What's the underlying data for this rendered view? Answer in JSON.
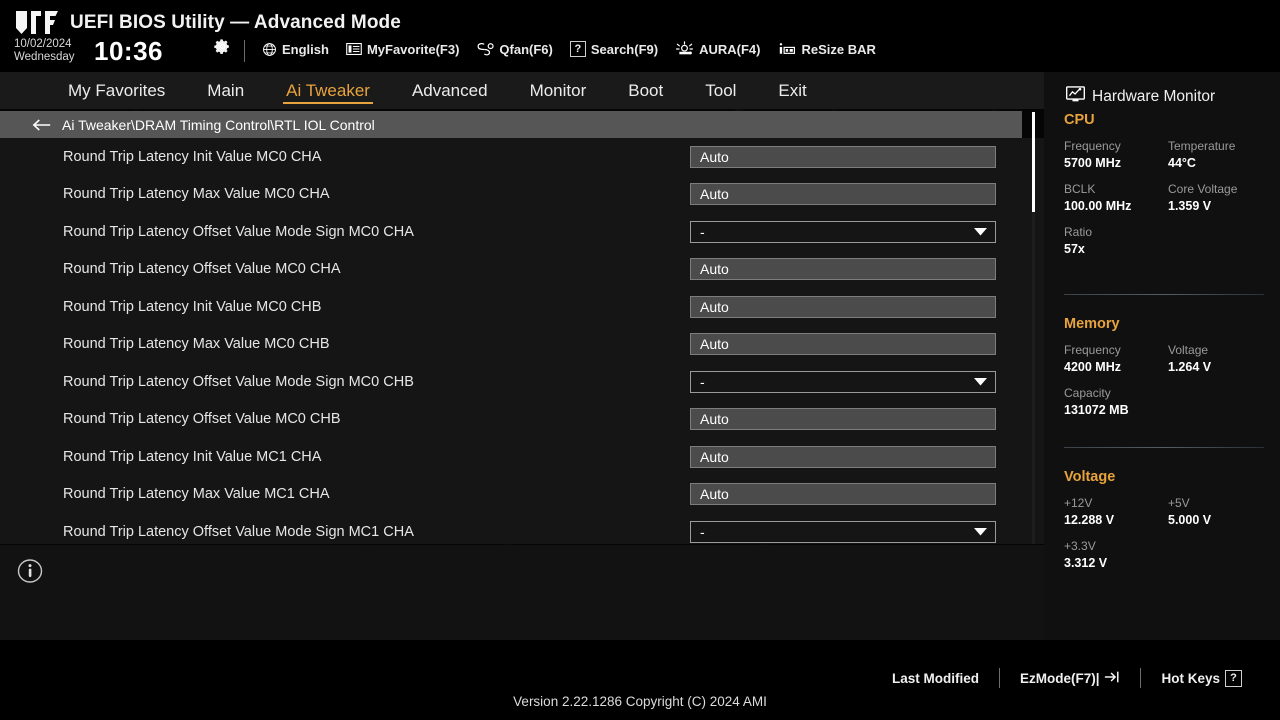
{
  "header": {
    "logo_name": "tuf-gaming-logo",
    "title": "UEFI BIOS Utility — Advanced Mode",
    "date": "10/02/2024",
    "weekday": "Wednesday",
    "time": "10:36",
    "gear_icon": "gear-icon",
    "tools": [
      {
        "icon": "globe-icon",
        "label": "English"
      },
      {
        "icon": "myfavorite-icon",
        "label": "MyFavorite(F3)"
      },
      {
        "icon": "qfan-icon",
        "label": "Qfan(F6)"
      },
      {
        "icon": "question-box-icon",
        "label": "Search(F9)"
      },
      {
        "icon": "aura-icon",
        "label": "AURA(F4)"
      },
      {
        "icon": "resize-bar-icon",
        "label": "ReSize BAR"
      }
    ]
  },
  "tabs": [
    {
      "label": "My Favorites",
      "active": false
    },
    {
      "label": "Main",
      "active": false
    },
    {
      "label": "Ai Tweaker",
      "active": true
    },
    {
      "label": "Advanced",
      "active": false
    },
    {
      "label": "Monitor",
      "active": false
    },
    {
      "label": "Boot",
      "active": false
    },
    {
      "label": "Tool",
      "active": false
    },
    {
      "label": "Exit",
      "active": false
    }
  ],
  "breadcrumb": {
    "back_icon": "back-arrow-icon",
    "path": "Ai Tweaker\\DRAM Timing Control\\RTL IOL Control"
  },
  "settings": [
    {
      "label": "Round Trip Latency Init Value MC0 CHA",
      "value": "Auto",
      "type": "text"
    },
    {
      "label": "Round Trip Latency Max Value MC0 CHA",
      "value": "Auto",
      "type": "text"
    },
    {
      "label": "Round Trip Latency Offset Value Mode Sign MC0 CHA",
      "value": "-",
      "type": "select"
    },
    {
      "label": "Round Trip Latency Offset Value MC0 CHA",
      "value": "Auto",
      "type": "text"
    },
    {
      "label": "Round Trip Latency Init Value MC0 CHB",
      "value": "Auto",
      "type": "text"
    },
    {
      "label": "Round Trip Latency Max Value MC0 CHB",
      "value": "Auto",
      "type": "text"
    },
    {
      "label": "Round Trip Latency Offset Value Mode Sign MC0 CHB",
      "value": "-",
      "type": "select"
    },
    {
      "label": "Round Trip Latency Offset Value MC0 CHB",
      "value": "Auto",
      "type": "text"
    },
    {
      "label": "Round Trip Latency Init Value MC1 CHA",
      "value": "Auto",
      "type": "text"
    },
    {
      "label": "Round Trip Latency Max Value MC1 CHA",
      "value": "Auto",
      "type": "text"
    },
    {
      "label": "Round Trip Latency Offset Value Mode Sign MC1 CHA",
      "value": "-",
      "type": "select"
    }
  ],
  "help": {
    "info_icon": "info-icon",
    "text": ""
  },
  "hardware_monitor": {
    "icon": "monitor-icon",
    "title": "Hardware Monitor",
    "sections": [
      {
        "name": "CPU",
        "items": [
          {
            "key": "Frequency",
            "value": "5700 MHz"
          },
          {
            "key": "Temperature",
            "value": "44°C"
          },
          {
            "key": "BCLK",
            "value": "100.00 MHz"
          },
          {
            "key": "Core Voltage",
            "value": "1.359 V"
          },
          {
            "key": "Ratio",
            "value": "57x"
          }
        ]
      },
      {
        "name": "Memory",
        "items": [
          {
            "key": "Frequency",
            "value": "4200 MHz"
          },
          {
            "key": "Voltage",
            "value": "1.264 V"
          },
          {
            "key": "Capacity",
            "value": "131072 MB"
          }
        ]
      },
      {
        "name": "Voltage",
        "items": [
          {
            "key": "+12V",
            "value": "12.288 V"
          },
          {
            "key": "+5V",
            "value": "5.000 V"
          },
          {
            "key": "+3.3V",
            "value": "3.312 V"
          }
        ]
      }
    ]
  },
  "footer": {
    "links": [
      {
        "label": "Last Modified",
        "icon": ""
      },
      {
        "label": "EzMode(F7)|",
        "icon": "exit-arrow-icon"
      },
      {
        "label": "Hot Keys",
        "icon": "question-box-icon"
      }
    ],
    "version": "Version 2.22.1286 Copyright (C) 2024 AMI"
  },
  "colors": {
    "accent": "#e8a33d",
    "breadcrumb_bg": "#565656",
    "content_bg": "#151515",
    "field_bg": "#4b4b4b"
  }
}
